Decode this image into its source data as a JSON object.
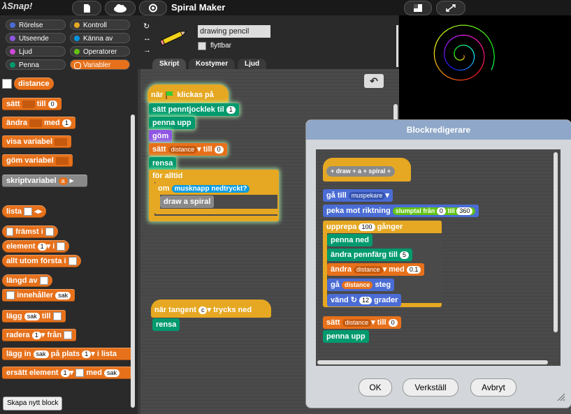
{
  "app": {
    "logo": "λSnap!",
    "title": "Spiral Maker"
  },
  "categories": [
    {
      "label": "Rörelse",
      "color": "#4a6cd4"
    },
    {
      "label": "Kontroll",
      "color": "#e6a822"
    },
    {
      "label": "Utseende",
      "color": "#8f56e3"
    },
    {
      "label": "Känna av",
      "color": "#0494dc"
    },
    {
      "label": "Ljud",
      "color": "#cf4ad9"
    },
    {
      "label": "Operatorer",
      "color": "#62c213"
    },
    {
      "label": "Penna",
      "color": "#009a6e"
    },
    {
      "label": "Variabler",
      "color": "#e7711b"
    }
  ],
  "palette": {
    "var_name": "distance",
    "set_label": "sätt",
    "set_to": "till",
    "set_value": "0",
    "change_label": "ändra",
    "change_by": "med",
    "change_value": "1",
    "show_var": "visa variabel",
    "hide_var": "göm variabel",
    "script_var": "skriptvariabel",
    "script_var_arg": "a",
    "list": "lista",
    "front_in": "främst i",
    "element": "element",
    "element_num": "1",
    "element_in": "i",
    "all_but_first": "allt utom första i",
    "length_of": "längd av",
    "contains": "innehåller",
    "thing": "sak",
    "add": "lägg",
    "add_to": "till",
    "delete": "radera",
    "delete_num": "1",
    "delete_from": "från",
    "insert": "lägg in",
    "insert_at": "på plats",
    "insert_num": "1",
    "insert_in": "i lista",
    "replace": "ersätt element",
    "replace_num": "1",
    "replace_with": "med",
    "new_block_button": "Skapa nytt block"
  },
  "sprite": {
    "name": "drawing pencil",
    "draggable_label": "flyttbar"
  },
  "tabs": [
    "Skript",
    "Kostymer",
    "Ljud"
  ],
  "script1": {
    "hat": "när",
    "hat_clicked": "klickas på",
    "pen_size_label": "sätt penntjocklek til",
    "pen_size": "1",
    "pen_up": "penna upp",
    "hide": "göm",
    "set": "sätt",
    "set_var": "distance",
    "set_to": "till",
    "set_value": "0",
    "clear": "rensa",
    "forever": "för alltid",
    "if": "om",
    "mouse_down": "musknapp nedtryckt?",
    "draw_call": "draw a spiral"
  },
  "script2": {
    "hat": "när tangent",
    "key": "c",
    "pressed": "trycks ned",
    "clear": "rensa"
  },
  "editor": {
    "title": "Blockredigerare",
    "proto": [
      "draw",
      "a",
      "spiral"
    ],
    "goto": "gå till",
    "goto_target": "muspekare",
    "point": "peka mot riktning",
    "random": "slumptal från",
    "random_from": "0",
    "random_to_label": "till",
    "random_to": "360",
    "repeat": "upprepa",
    "repeat_count": "100",
    "repeat_times": "gånger",
    "pen_down": "penna ned",
    "change_color": "ändra pennfärg till",
    "change_color_value": "5",
    "change": "ändra",
    "change_var": "distance",
    "change_by": "med",
    "change_value": "0.1",
    "move": "gå",
    "move_var": "distance",
    "move_steps": "steg",
    "turn": "vänd",
    "turn_value": "12",
    "turn_degrees": "grader",
    "set": "sätt",
    "set_var": "distance",
    "set_to": "till",
    "set_value": "0",
    "pen_up": "penna upp",
    "ok": "OK",
    "apply": "Verkställ",
    "cancel": "Avbryt"
  },
  "colors": {
    "accent": "#e7711b",
    "control": "#e6a822",
    "pen": "#009a6e",
    "motion": "#4a6cd4"
  }
}
